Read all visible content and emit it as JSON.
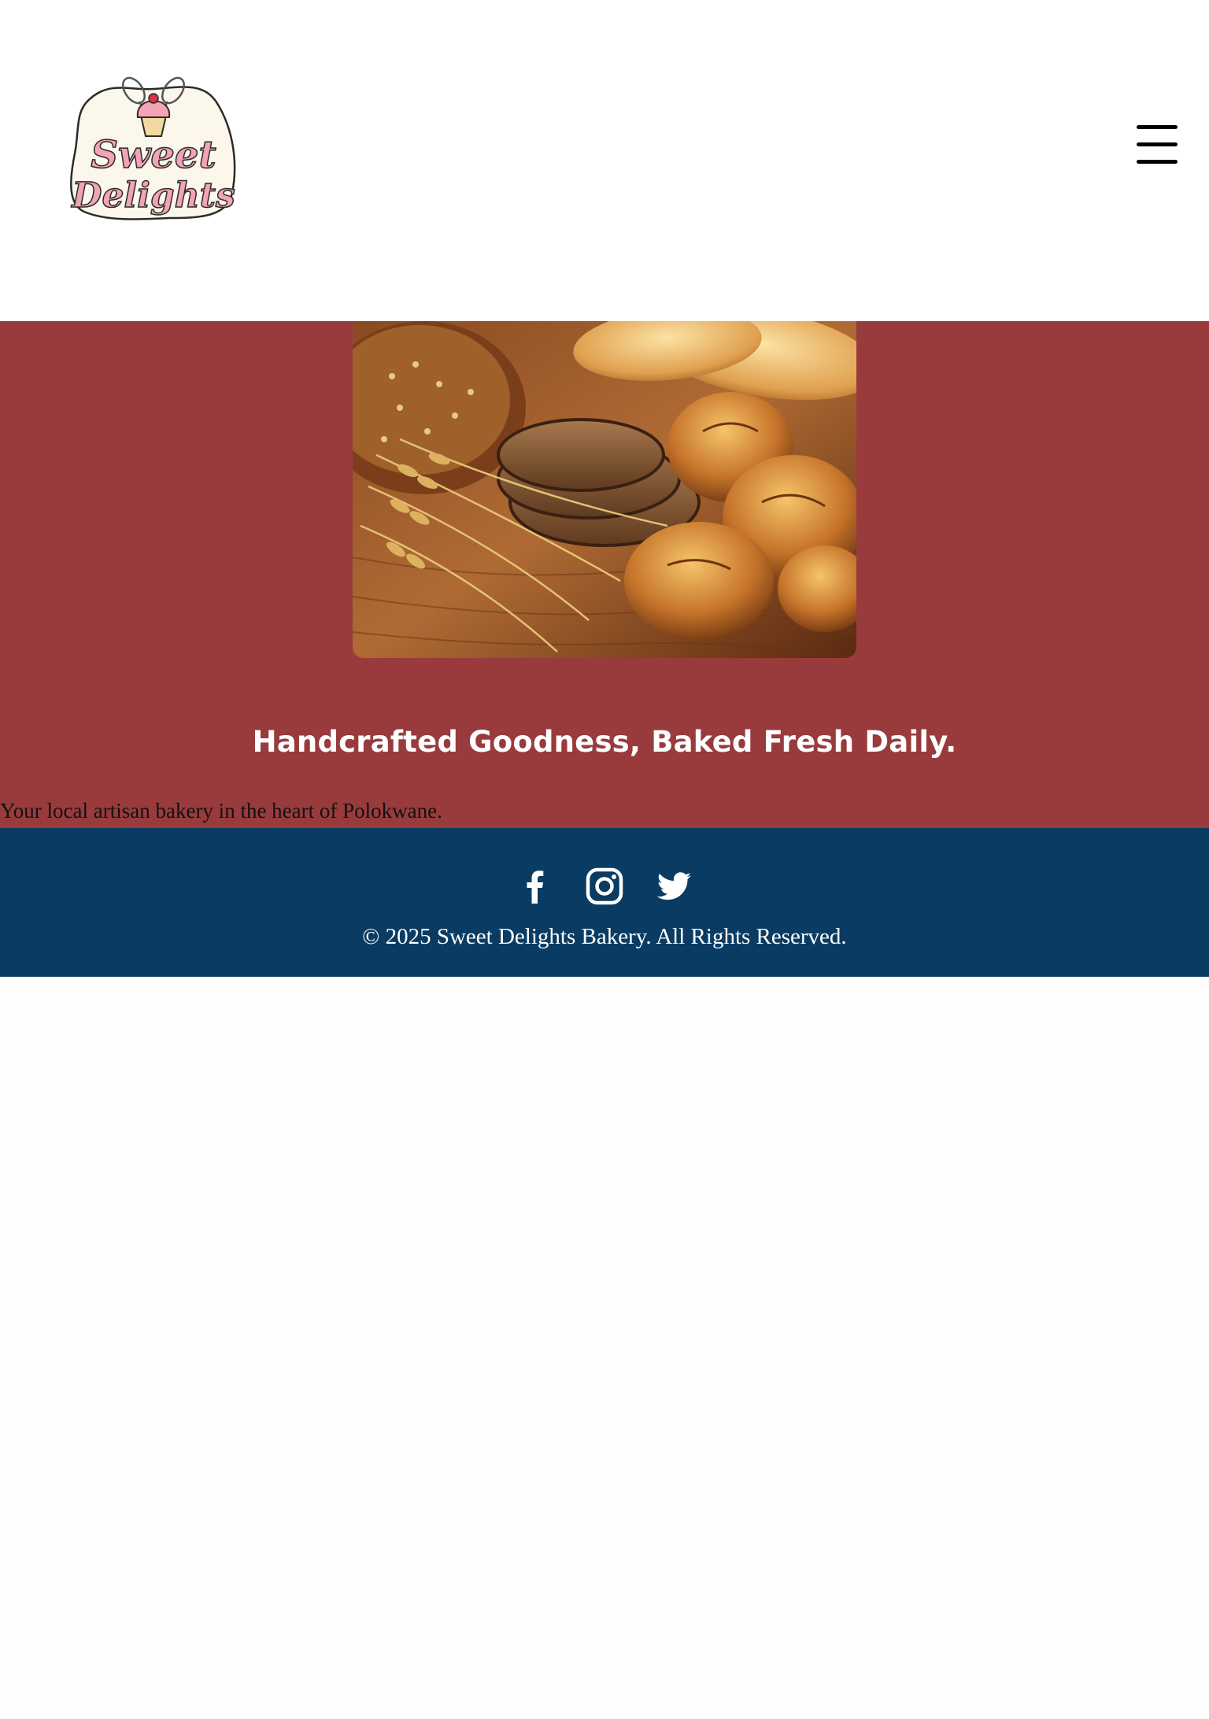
{
  "header": {
    "logo_alt": "Sweet Delights",
    "logo_line1": "Sweet",
    "logo_line2": "Delights",
    "menu_icon": "hamburger-menu-icon"
  },
  "hero": {
    "image_alt": "Assorted artisan breads and wheat on a wooden table",
    "title": "Handcrafted Goodness, Baked Fresh Daily.",
    "subtitle": "Your local artisan bakery in the heart of Polokwane."
  },
  "footer": {
    "social": [
      {
        "icon": "facebook-icon",
        "label": "Facebook"
      },
      {
        "icon": "instagram-icon",
        "label": "Instagram"
      },
      {
        "icon": "twitter-icon",
        "label": "Twitter"
      }
    ],
    "copyright": "© 2025 Sweet Delights Bakery. All Rights Reserved."
  },
  "colors": {
    "hero_bg": "#993b3d",
    "footer_bg": "#0a3c63",
    "logo_pink": "#e8849a",
    "logo_cream": "#fbf7ea"
  }
}
